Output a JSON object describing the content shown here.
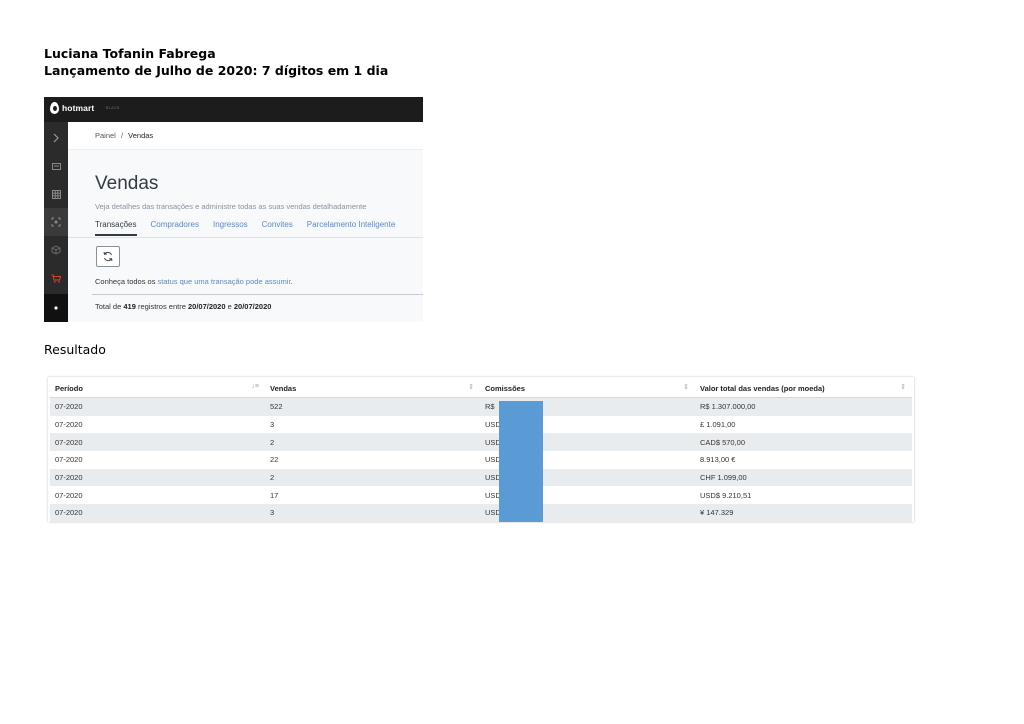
{
  "document": {
    "author": "Luciana Tofanin Fabrega",
    "headline": "Lançamento de Julho de 2020: 7 dígitos em 1 dia",
    "result_label": "Resultado"
  },
  "hotmart": {
    "logo_text": "hotmart",
    "logo_sub": "BLACK",
    "breadcrumb": {
      "root": "Painel",
      "separator": "/",
      "current": "Vendas"
    },
    "title": "Vendas",
    "subtitle": "Veja detalhes das transações e administre todas as suas vendas detalhadamente",
    "tabs": [
      {
        "label": "Transações",
        "active": true
      },
      {
        "label": "Compradores"
      },
      {
        "label": "Ingressos"
      },
      {
        "label": "Convites"
      },
      {
        "label": "Parcelamento Inteligente"
      }
    ],
    "info_prefix": "Conheça todos os ",
    "info_link": "status que uma transação pode assumir",
    "info_suffix": ".",
    "total_prefix": "Total de ",
    "total_count": "419",
    "total_mid": " registros entre ",
    "total_from": "20/07/2020",
    "total_and": " e ",
    "total_to": "20/07/2020",
    "sidebar_icons": [
      "chevron-right-icon",
      "card-icon",
      "grid-icon",
      "scan-icon",
      "box-icon",
      "cart-icon",
      "dot-icon"
    ],
    "colors": {
      "topbar": "#1c1c1c",
      "accent": "#e0442d",
      "link": "#5d87c6"
    }
  },
  "results_table": {
    "headers": [
      "Período",
      "Vendas",
      "Comissões",
      "Valor total das vendas (por moeda)"
    ],
    "rows": [
      [
        "07-2020",
        "522",
        "R$",
        "R$ 1.307.000,00"
      ],
      [
        "07-2020",
        "3",
        "USD",
        "£ 1.091,00"
      ],
      [
        "07-2020",
        "2",
        "USD",
        "CAD$ 570,00"
      ],
      [
        "07-2020",
        "22",
        "USD",
        "8.913,00 €"
      ],
      [
        "07-2020",
        "2",
        "USD",
        "CHF 1.099,00"
      ],
      [
        "07-2020",
        "17",
        "USD",
        "USD$ 9.210,51"
      ],
      [
        "07-2020",
        "3",
        "USD",
        "¥ 147.329"
      ]
    ],
    "redaction_color": "#5b9bd5"
  }
}
